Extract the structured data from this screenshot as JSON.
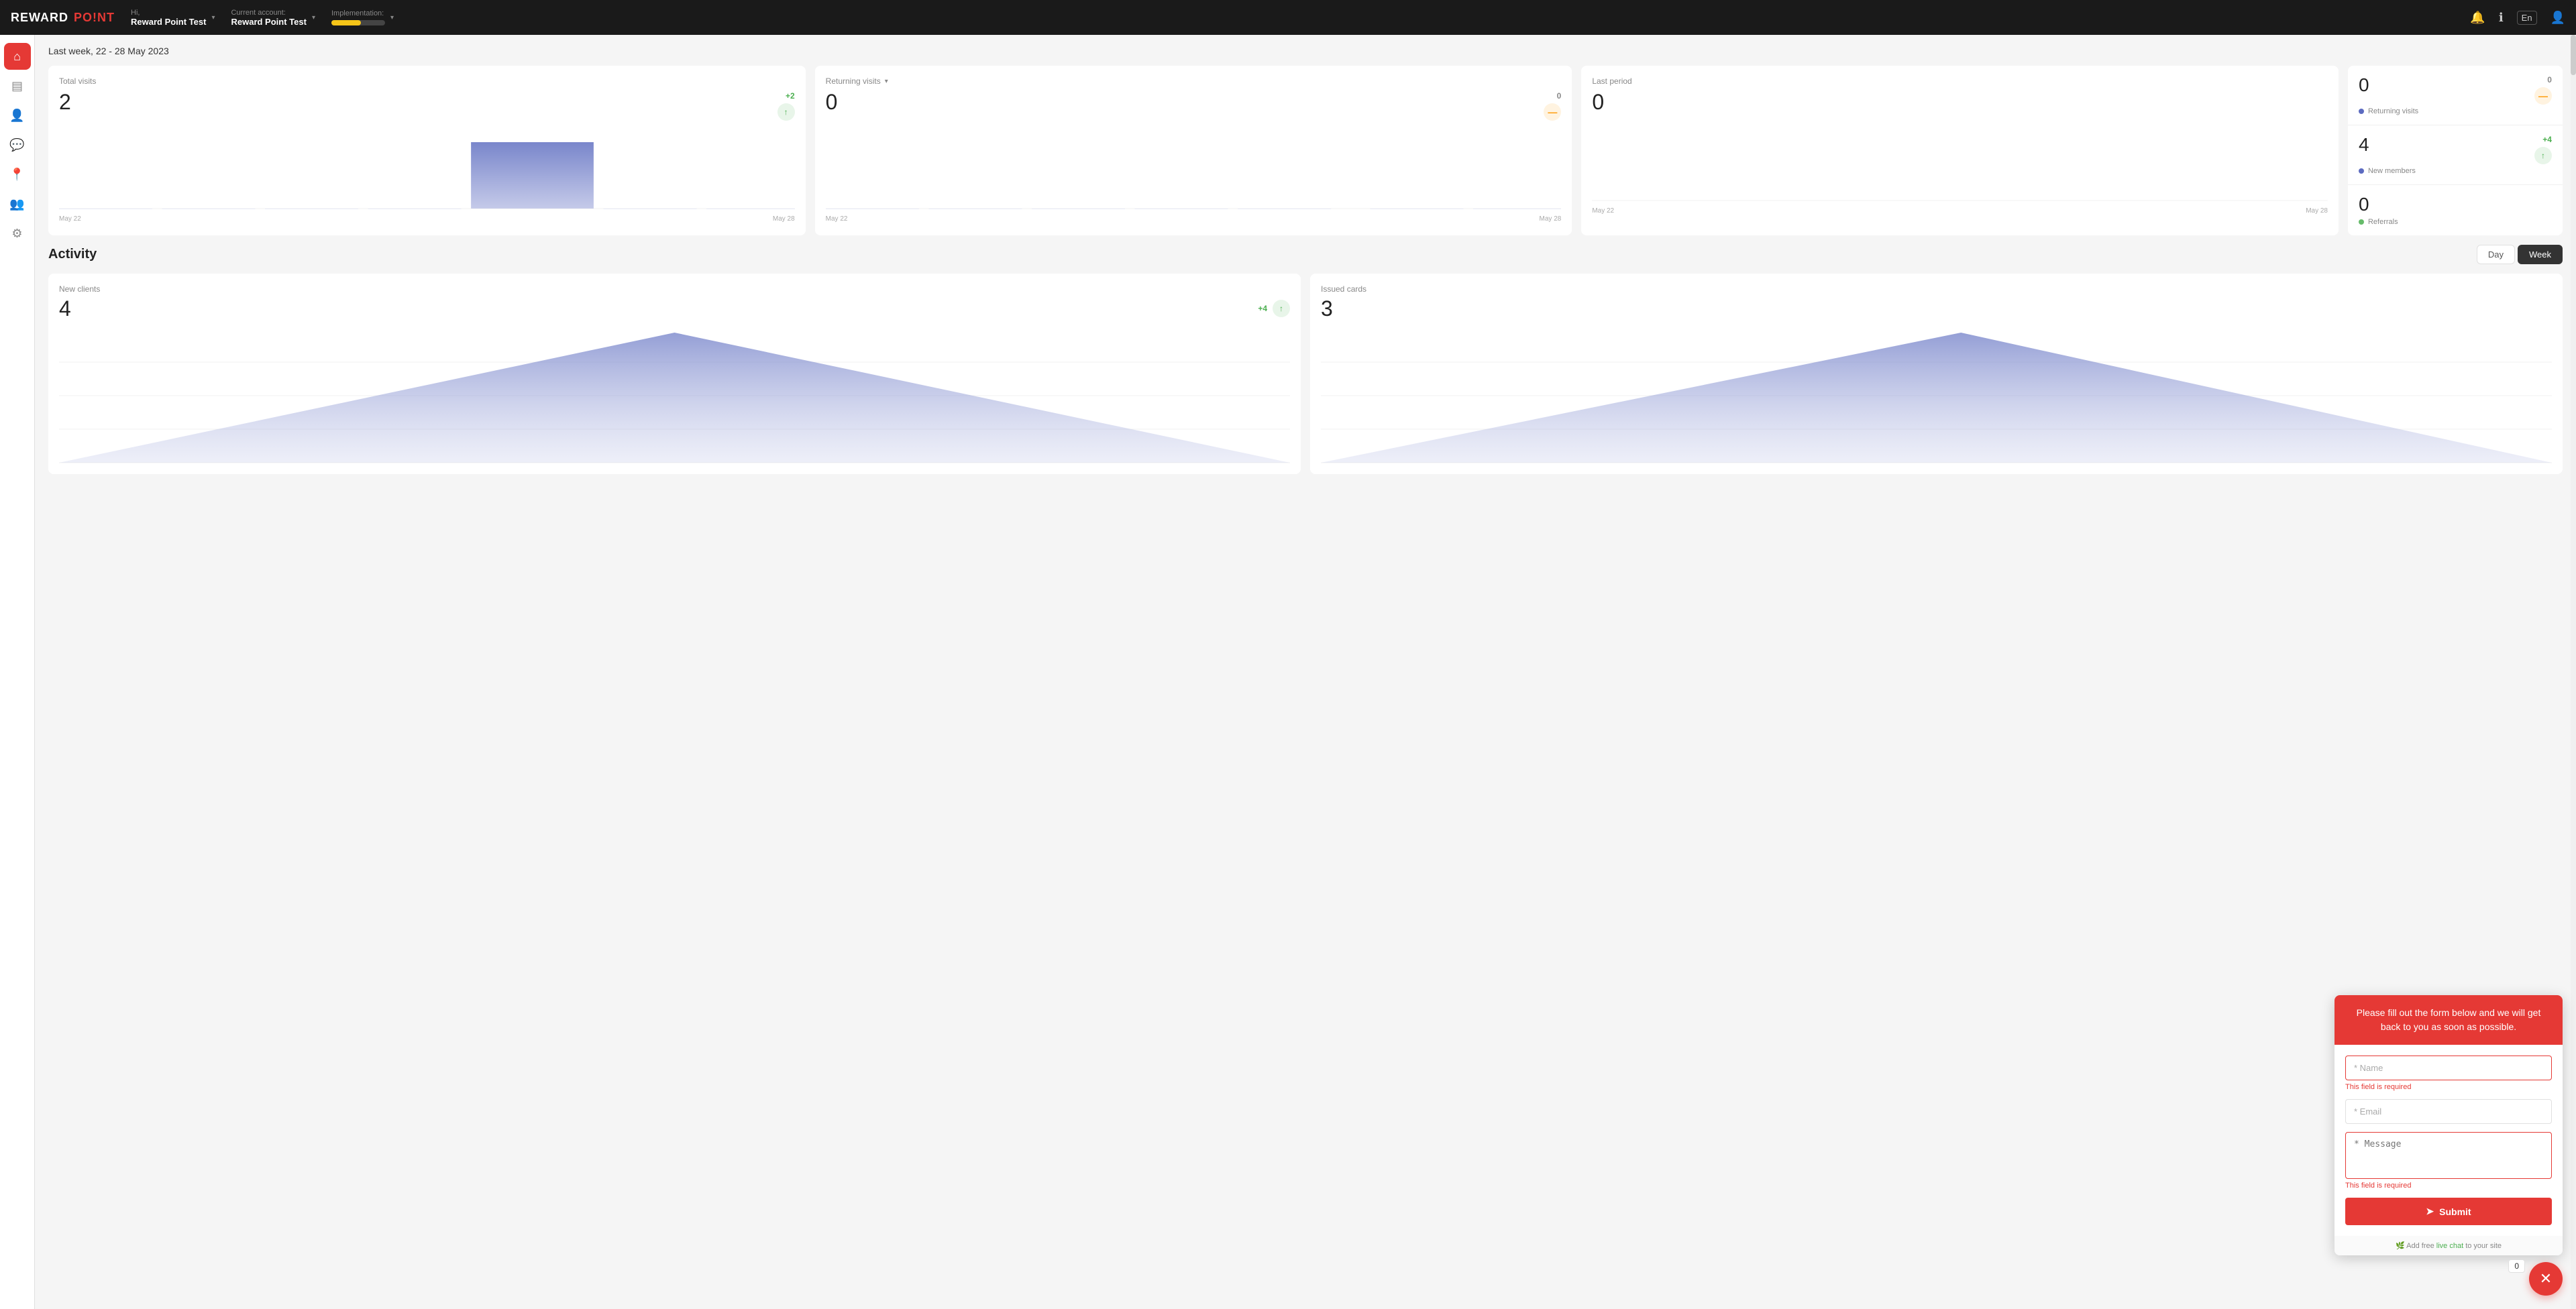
{
  "navbar": {
    "logo_reward": "REWARD",
    "logo_point": "PO!NT",
    "hi_label": "Hi,",
    "account_user": "Reward Point Test",
    "current_account_label": "Current account:",
    "current_account_value": "Reward Point Test",
    "implementation_label": "Implementation:",
    "progress_pct": 55,
    "lang": "En"
  },
  "sidebar": {
    "items": [
      {
        "id": "home",
        "icon": "⌂",
        "active": true
      },
      {
        "id": "cards",
        "icon": "▤",
        "active": false
      },
      {
        "id": "clients",
        "icon": "👤",
        "active": false
      },
      {
        "id": "chat",
        "icon": "💬",
        "active": false
      },
      {
        "id": "location",
        "icon": "📍",
        "active": false
      },
      {
        "id": "users",
        "icon": "👥",
        "active": false
      },
      {
        "id": "settings",
        "icon": "⚙",
        "active": false
      }
    ]
  },
  "page": {
    "date_range": "Last week, 22 - 28 May 2023",
    "stats": {
      "total_visits": {
        "label": "Total visits",
        "value": "2",
        "delta": "+2",
        "delta_type": "positive"
      },
      "returning_visits": {
        "label": "Returning visits",
        "value": "0",
        "delta": "0",
        "delta_type": "neutral",
        "has_chevron": true
      },
      "last_period": {
        "label": "Last period",
        "value": "0"
      }
    },
    "right_panel": {
      "returning": {
        "value": "0",
        "label": "Returning visits",
        "delta": "0",
        "delta_type": "neutral"
      },
      "new_members": {
        "value": "4",
        "label": "New members",
        "delta": "+4",
        "delta_type": "positive"
      },
      "referrals": {
        "value": "0",
        "label": "Referrals",
        "dot_color": "green"
      }
    },
    "chart_dates": {
      "start": "May 22",
      "end": "May 28"
    },
    "activity": {
      "title": "Activity",
      "toggle_day": "Day",
      "toggle_week": "Week",
      "new_clients": {
        "label": "New clients",
        "value": "4",
        "delta": "+4",
        "delta_type": "positive"
      },
      "issued_cards": {
        "label": "Issued cards",
        "value": "3",
        "delta": "",
        "delta_type": "neutral"
      }
    }
  },
  "contact_form": {
    "header_text": "Please fill out the form below and we will get back to you as soon as possible.",
    "name_placeholder": "* Name",
    "name_error": "This field is required",
    "email_placeholder": "* Email",
    "message_placeholder": "* Message",
    "message_error": "This field is required",
    "submit_label": "Submit",
    "footer_text": "Add free live chat to your site"
  },
  "chat_bubble": {
    "icon": "✕",
    "count": "0"
  }
}
